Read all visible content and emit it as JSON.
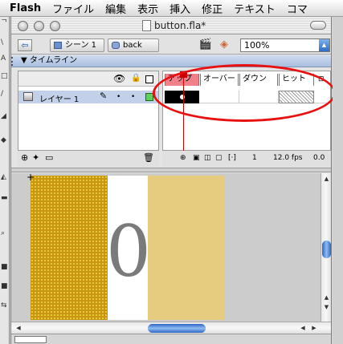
{
  "menubar": {
    "app": "Flash",
    "items": [
      "ファイル",
      "編集",
      "表示",
      "挿入",
      "修正",
      "テキスト",
      "コマ"
    ]
  },
  "window": {
    "title": "button.fla*",
    "edit_bar": {
      "scene": "シーン 1",
      "symbol": "back",
      "zoom": "100%"
    }
  },
  "timeline": {
    "panel_title": "▼ タイムライン",
    "layer": {
      "name": "レイヤー 1"
    },
    "frame_labels": [
      "アップ",
      "オーバー",
      "ダウン",
      "ヒット"
    ],
    "current_frame": "1",
    "frame_rate": "12.0 fps",
    "elapsed": "0.0"
  },
  "stage": {
    "digit": "0"
  },
  "icons": {
    "eye": "eye-icon",
    "lock": "lock-icon",
    "outline": "outline-icon",
    "pencil": "pencil-icon",
    "trash": "trash-icon",
    "add_layer": "add-layer-icon"
  },
  "colors": {
    "up_frame_label": "#f0818a",
    "playhead": "#cc0000",
    "callout": "#e81010",
    "gold_panel": "#c9960f",
    "beige_panel": "#e5cc7e",
    "layer_selected": "#c2d1e9"
  }
}
